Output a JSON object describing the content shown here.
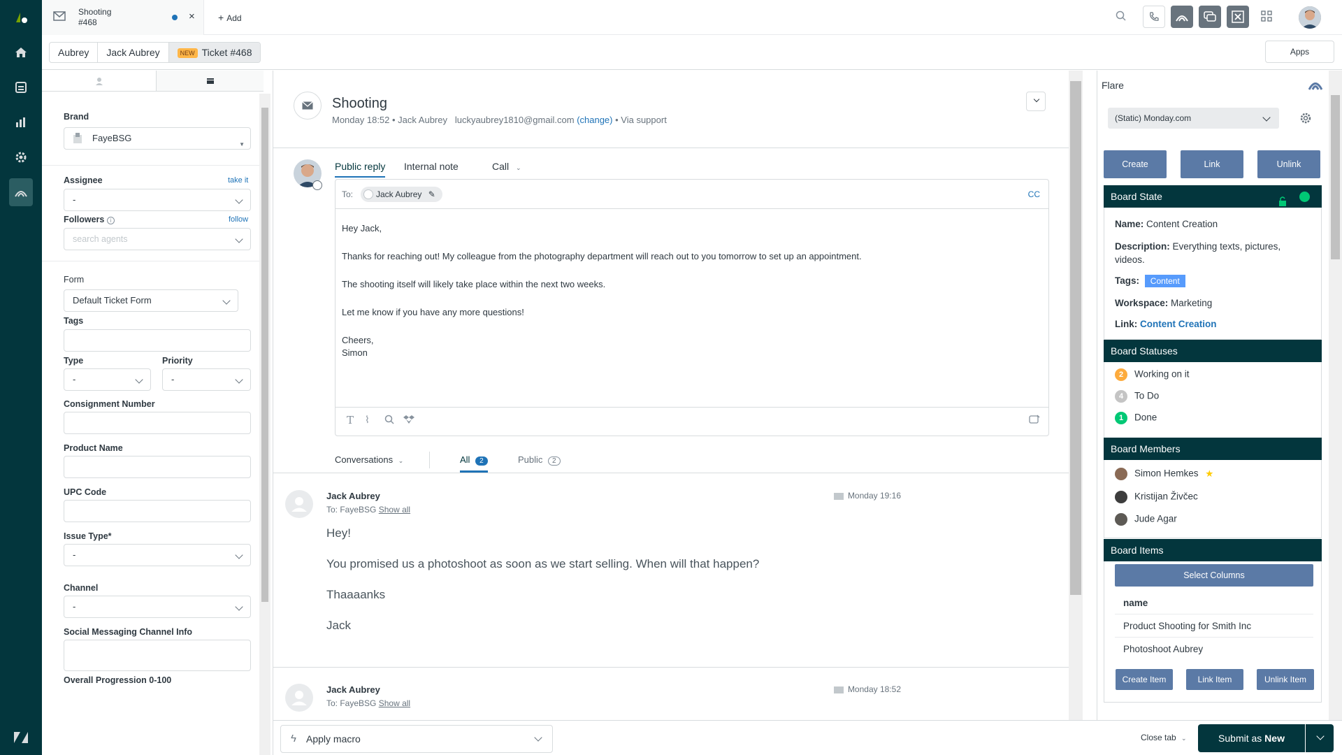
{
  "header": {
    "tab_title_line1": "Shooting",
    "tab_title_line2": "#468",
    "tab_close": "×",
    "add_label": "Add",
    "apps_label": "Apps"
  },
  "breadcrumb": {
    "items": [
      "Aubrey",
      "Jack Aubrey",
      "Ticket #468"
    ],
    "new_badge": "NEW"
  },
  "properties": {
    "brand_label": "Brand",
    "brand_value": "FayeBSG",
    "assignee_label": "Assignee",
    "take_it": "take it",
    "assignee_value": "-",
    "followers_label": "Followers",
    "follow": "follow",
    "followers_placeholder": "search agents",
    "form_label": "Form",
    "form_value": "Default Ticket Form",
    "tags_label": "Tags",
    "type_label": "Type",
    "type_value": "-",
    "priority_label": "Priority",
    "priority_value": "-",
    "consignment_label": "Consignment Number",
    "product_label": "Product Name",
    "upc_label": "UPC Code",
    "issue_type_label": "Issue Type*",
    "issue_type_value": "-",
    "channel_label": "Channel",
    "channel_value": "-",
    "social_label": "Social Messaging Channel Info",
    "progression_label": "Overall Progression 0-100"
  },
  "ticket": {
    "title": "Shooting",
    "meta_prefix": "Monday 18:52 • Jack Aubrey",
    "email": "luckyaubrey1810@gmail.com",
    "change": "(change)",
    "via": "• Via support"
  },
  "reply": {
    "tabs": [
      "Public reply",
      "Internal note",
      "Call"
    ],
    "to_label": "To:",
    "recipient": "Jack Aubrey",
    "cc": "CC",
    "body": [
      "Hey Jack,",
      "Thanks for reaching out! My colleague from the photography department will reach out to you tomorrow to set up an appointment.",
      "The shooting itself will likely take place within the next two weeks.",
      "Let me know if you have any more questions!",
      "Cheers,",
      "Simon"
    ]
  },
  "conversation_filter": {
    "conversations": "Conversations",
    "all": "All",
    "all_count": "2",
    "public": "Public",
    "public_count": "2"
  },
  "messages": [
    {
      "author": "Jack Aubrey",
      "to": "To: FayeBSG",
      "show_all": "Show all",
      "time": "Monday 19:16",
      "lines": [
        "Hey!",
        "You promised us a photoshoot as soon as we start selling. When will that happen?",
        "Thaaaanks",
        "Jack"
      ]
    },
    {
      "author": "Jack Aubrey",
      "to": "To: FayeBSG",
      "show_all": "Show all",
      "time": "Monday 18:52"
    }
  ],
  "footer": {
    "apply_macro": "Apply macro",
    "close_tab": "Close tab",
    "submit_prefix": "Submit as",
    "submit_status": "New"
  },
  "flare": {
    "title": "Flare",
    "board_select": "(Static) Monday.com",
    "buttons": [
      "Create",
      "Link",
      "Unlink"
    ],
    "state_header": "Board State",
    "name_label": "Name:",
    "name_value": "Content Creation",
    "desc_label": "Description:",
    "desc_value": "Everything texts, pictures, videos.",
    "tags_label": "Tags:",
    "tag_value": "Content",
    "workspace_label": "Workspace:",
    "workspace_value": "Marketing",
    "link_label": "Link:",
    "link_value": "Content Creation",
    "statuses_header": "Board Statuses",
    "statuses": [
      {
        "count": "2",
        "label": "Working on it",
        "color": "#fdab3d"
      },
      {
        "count": "4",
        "label": "To Do",
        "color": "#c4c4c4"
      },
      {
        "count": "1",
        "label": "Done",
        "color": "#00c875"
      }
    ],
    "members_header": "Board Members",
    "members": [
      "Simon Hemkes",
      "Kristijan Živčec",
      "Jude Agar"
    ],
    "items_header": "Board Items",
    "select_columns": "Select Columns",
    "items_column": "name",
    "items": [
      "Product Shooting for Smith Inc",
      "Photoshoot Aubrey"
    ],
    "item_buttons": [
      "Create Item",
      "Link Item",
      "Unlink Item"
    ]
  },
  "colors": {
    "nav_bg": "#03363d",
    "accent_blue": "#1f73b7",
    "flare_button": "#5b7aa6",
    "submit_bg": "#03363d"
  }
}
